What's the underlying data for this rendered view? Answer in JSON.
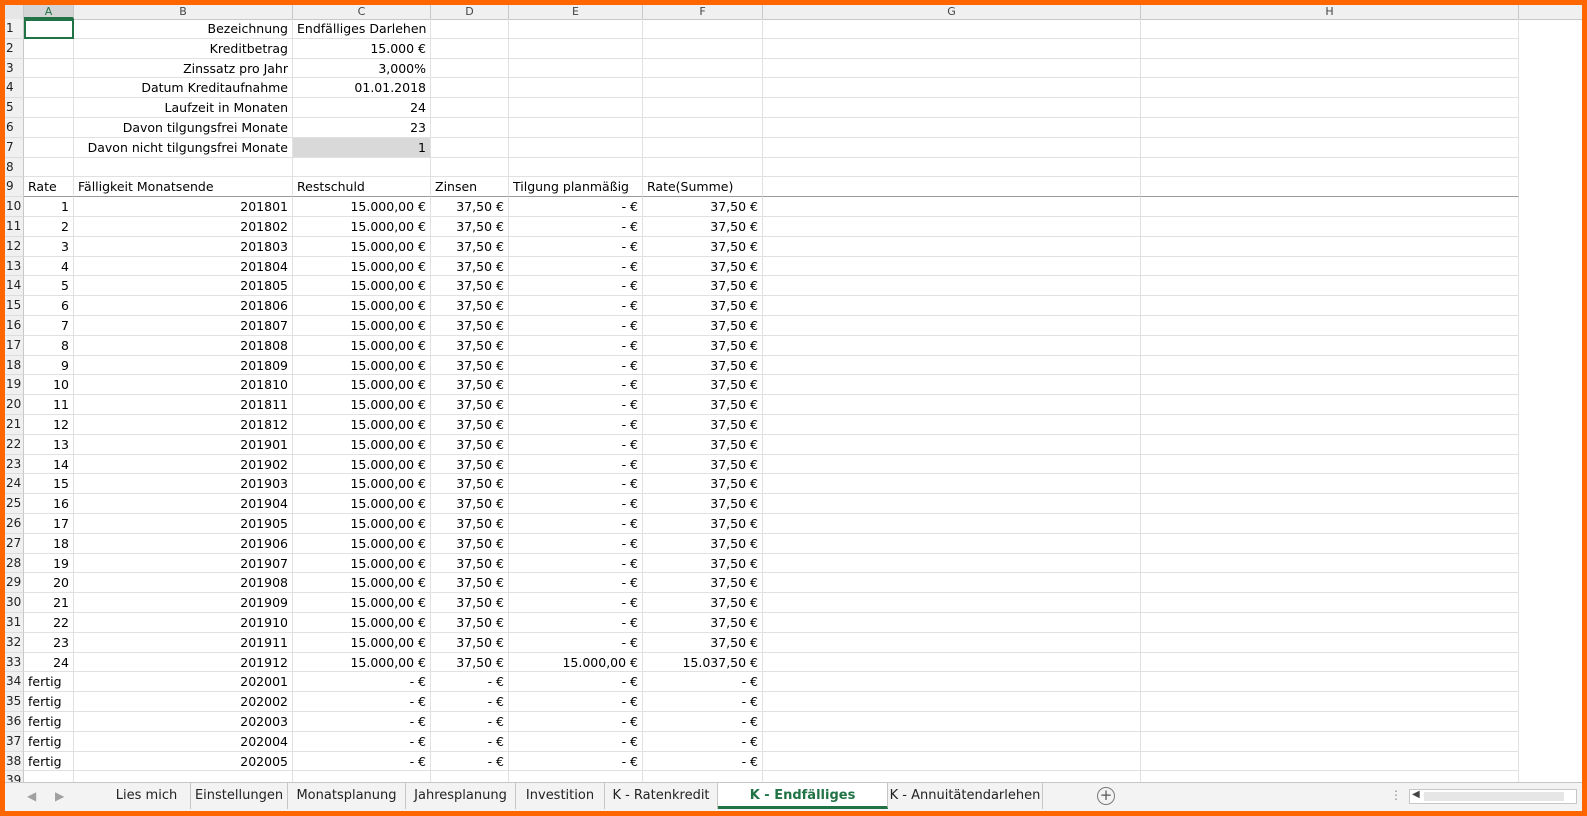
{
  "columns": [
    "A",
    "B",
    "C",
    "D",
    "E",
    "F",
    "G",
    "H"
  ],
  "info": [
    {
      "label": "Bezeichnung",
      "value": "Endfälliges Darlehen"
    },
    {
      "label": "Kreditbetrag",
      "value": "15.000 €"
    },
    {
      "label": "Zinssatz pro Jahr",
      "value": "3,000%"
    },
    {
      "label": "Datum Kreditaufnahme",
      "value": "01.01.2018"
    },
    {
      "label": "Laufzeit in Monaten",
      "value": "24"
    },
    {
      "label": "Davon tilgungsfrei Monate",
      "value": "23"
    },
    {
      "label": "Davon nicht tilgungsfrei Monate",
      "value": "1"
    }
  ],
  "table_headers": [
    "Rate",
    "Fälligkeit Monatsende",
    "Restschuld",
    "Zinsen",
    "Tilgung planmäßig",
    "Rate(Summe)"
  ],
  "rows": [
    [
      "1",
      "201801",
      "15.000,00 €",
      "37,50 €",
      "-  €",
      "37,50 €"
    ],
    [
      "2",
      "201802",
      "15.000,00 €",
      "37,50 €",
      "-  €",
      "37,50 €"
    ],
    [
      "3",
      "201803",
      "15.000,00 €",
      "37,50 €",
      "-  €",
      "37,50 €"
    ],
    [
      "4",
      "201804",
      "15.000,00 €",
      "37,50 €",
      "-  €",
      "37,50 €"
    ],
    [
      "5",
      "201805",
      "15.000,00 €",
      "37,50 €",
      "-  €",
      "37,50 €"
    ],
    [
      "6",
      "201806",
      "15.000,00 €",
      "37,50 €",
      "-  €",
      "37,50 €"
    ],
    [
      "7",
      "201807",
      "15.000,00 €",
      "37,50 €",
      "-  €",
      "37,50 €"
    ],
    [
      "8",
      "201808",
      "15.000,00 €",
      "37,50 €",
      "-  €",
      "37,50 €"
    ],
    [
      "9",
      "201809",
      "15.000,00 €",
      "37,50 €",
      "-  €",
      "37,50 €"
    ],
    [
      "10",
      "201810",
      "15.000,00 €",
      "37,50 €",
      "-  €",
      "37,50 €"
    ],
    [
      "11",
      "201811",
      "15.000,00 €",
      "37,50 €",
      "-  €",
      "37,50 €"
    ],
    [
      "12",
      "201812",
      "15.000,00 €",
      "37,50 €",
      "-  €",
      "37,50 €"
    ],
    [
      "13",
      "201901",
      "15.000,00 €",
      "37,50 €",
      "-  €",
      "37,50 €"
    ],
    [
      "14",
      "201902",
      "15.000,00 €",
      "37,50 €",
      "-  €",
      "37,50 €"
    ],
    [
      "15",
      "201903",
      "15.000,00 €",
      "37,50 €",
      "-  €",
      "37,50 €"
    ],
    [
      "16",
      "201904",
      "15.000,00 €",
      "37,50 €",
      "-  €",
      "37,50 €"
    ],
    [
      "17",
      "201905",
      "15.000,00 €",
      "37,50 €",
      "-  €",
      "37,50 €"
    ],
    [
      "18",
      "201906",
      "15.000,00 €",
      "37,50 €",
      "-  €",
      "37,50 €"
    ],
    [
      "19",
      "201907",
      "15.000,00 €",
      "37,50 €",
      "-  €",
      "37,50 €"
    ],
    [
      "20",
      "201908",
      "15.000,00 €",
      "37,50 €",
      "-  €",
      "37,50 €"
    ],
    [
      "21",
      "201909",
      "15.000,00 €",
      "37,50 €",
      "-  €",
      "37,50 €"
    ],
    [
      "22",
      "201910",
      "15.000,00 €",
      "37,50 €",
      "-  €",
      "37,50 €"
    ],
    [
      "23",
      "201911",
      "15.000,00 €",
      "37,50 €",
      "-  €",
      "37,50 €"
    ],
    [
      "24",
      "201912",
      "15.000,00 €",
      "37,50 €",
      "15.000,00 €",
      "15.037,50 €"
    ],
    [
      "fertig",
      "202001",
      "-  €",
      "-  €",
      "-  €",
      "-  €"
    ],
    [
      "fertig",
      "202002",
      "-  €",
      "-  €",
      "-  €",
      "-  €"
    ],
    [
      "fertig",
      "202003",
      "-  €",
      "-  €",
      "-  €",
      "-  €"
    ],
    [
      "fertig",
      "202004",
      "-  €",
      "-  €",
      "-  €",
      "-  €"
    ],
    [
      "fertig",
      "202005",
      "-  €",
      "-  €",
      "-  €",
      "-  €"
    ]
  ],
  "tabs": [
    "Lies mich",
    "Einstellungen",
    "Monatsplanung",
    "Jahresplanung",
    "Investition",
    "K - Ratenkredit",
    "K - Endfälliges Darlehen",
    "K - Annuitätendarlehen"
  ],
  "active_tab": "K - Endfälliges Darlehen",
  "colors": {
    "accent": "#217346",
    "frame": "#ff6600"
  }
}
